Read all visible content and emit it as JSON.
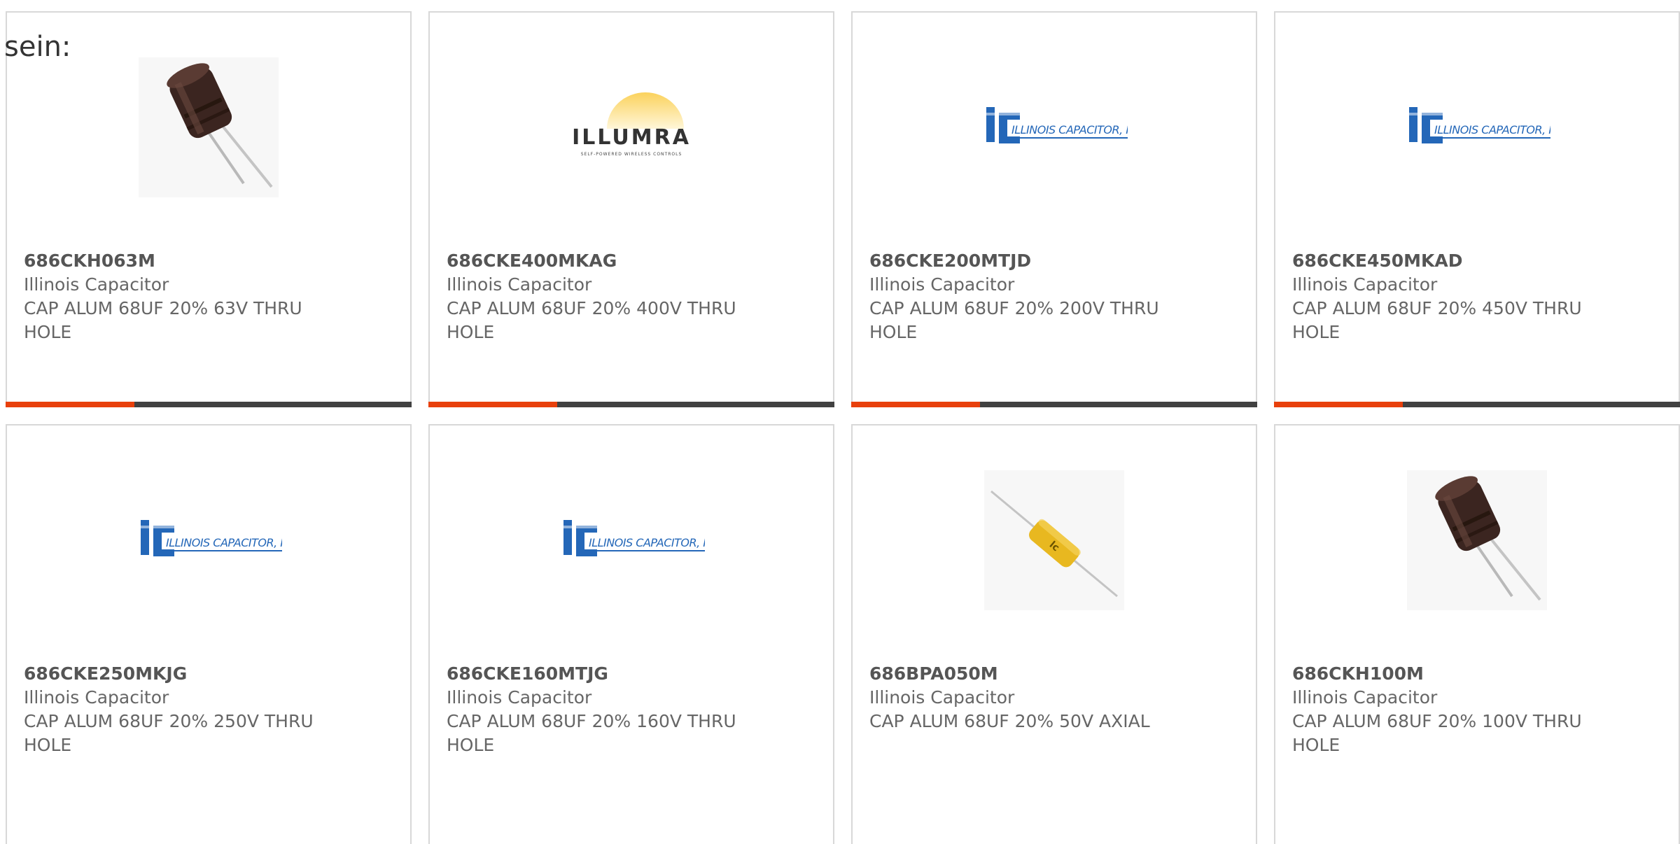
{
  "intro_text": "sein:",
  "colors": {
    "accent": "#e8400c",
    "bar": "#414141",
    "logo_blue": "#2467b8",
    "logo_gold": "#f4b63c"
  },
  "products": [
    {
      "part": "686CKH063M",
      "manufacturer": "Illinois Capacitor",
      "description": "CAP ALUM 68UF 20% 63V THRU HOLE",
      "image": "radial-capacitor"
    },
    {
      "part": "686CKE400MKAG",
      "manufacturer": "Illinois Capacitor",
      "description": "CAP ALUM 68UF 20% 400V THRU HOLE",
      "image": "illumra-logo",
      "logo_text": "ILLUMRA",
      "logo_tagline": "SELF-POWERED WIRELESS CONTROLS"
    },
    {
      "part": "686CKE200MTJD",
      "manufacturer": "Illinois Capacitor",
      "description": "CAP ALUM 68UF 20% 200V THRU HOLE",
      "image": "ic-logo",
      "logo_text": "ILLINOIS CAPACITOR, INC."
    },
    {
      "part": "686CKE450MKAD",
      "manufacturer": "Illinois Capacitor",
      "description": "CAP ALUM 68UF 20% 450V THRU HOLE",
      "image": "ic-logo",
      "logo_text": "ILLINOIS CAPACITOR, INC."
    },
    {
      "part": "686CKE250MKJG",
      "manufacturer": "Illinois Capacitor",
      "description": "CAP ALUM 68UF 20% 250V THRU HOLE",
      "image": "ic-logo",
      "logo_text": "ILLINOIS CAPACITOR, INC."
    },
    {
      "part": "686CKE160MTJG",
      "manufacturer": "Illinois Capacitor",
      "description": "CAP ALUM 68UF 20% 160V THRU HOLE",
      "image": "ic-logo",
      "logo_text": "ILLINOIS CAPACITOR, INC."
    },
    {
      "part": "686BPA050M",
      "manufacturer": "Illinois Capacitor",
      "description": "CAP ALUM 68UF 20% 50V AXIAL",
      "image": "axial-capacitor"
    },
    {
      "part": "686CKH100M",
      "manufacturer": "Illinois Capacitor",
      "description": "CAP ALUM 68UF 20% 100V THRU HOLE",
      "image": "radial-capacitor"
    }
  ]
}
